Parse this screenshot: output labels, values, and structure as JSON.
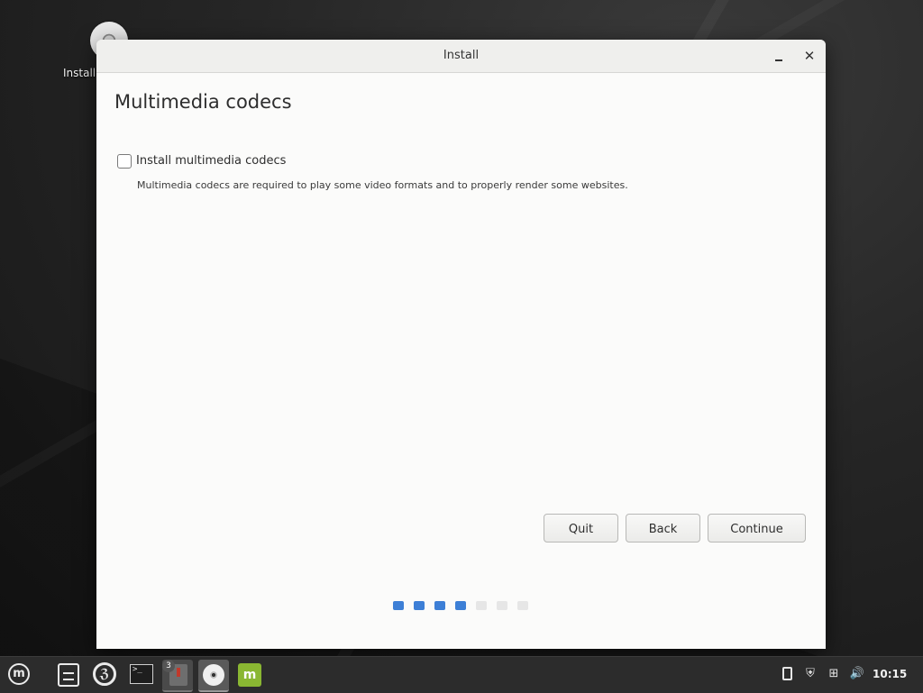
{
  "desktop": {
    "icon_label": "Install"
  },
  "window": {
    "title": "Install",
    "minimize_symbol": "–",
    "close_symbol": "✕"
  },
  "page": {
    "title": "Multimedia codecs",
    "codec_checkbox_label": "Install multimedia codecs",
    "codec_checkbox_checked": false,
    "codec_description": "Multimedia codecs are required to play some video formats and to properly render some websites."
  },
  "buttons": {
    "quit": "Quit",
    "back": "Back",
    "continue": "Continue"
  },
  "progress": {
    "total_steps": 7,
    "completed_steps": 4,
    "active_color": "#3d7fd6",
    "inactive_color": "#e6e6e6"
  },
  "taskbar": {
    "menu_glyph": "m",
    "firefox_glyph": "ℨ",
    "terminal_glyph": ">_",
    "windows_badge": "3",
    "mint_glyph": "m",
    "tray": {
      "shield_glyph": "⛨",
      "network_glyph": "⊞",
      "volume_glyph": "🔊",
      "clock": "10:15"
    }
  }
}
